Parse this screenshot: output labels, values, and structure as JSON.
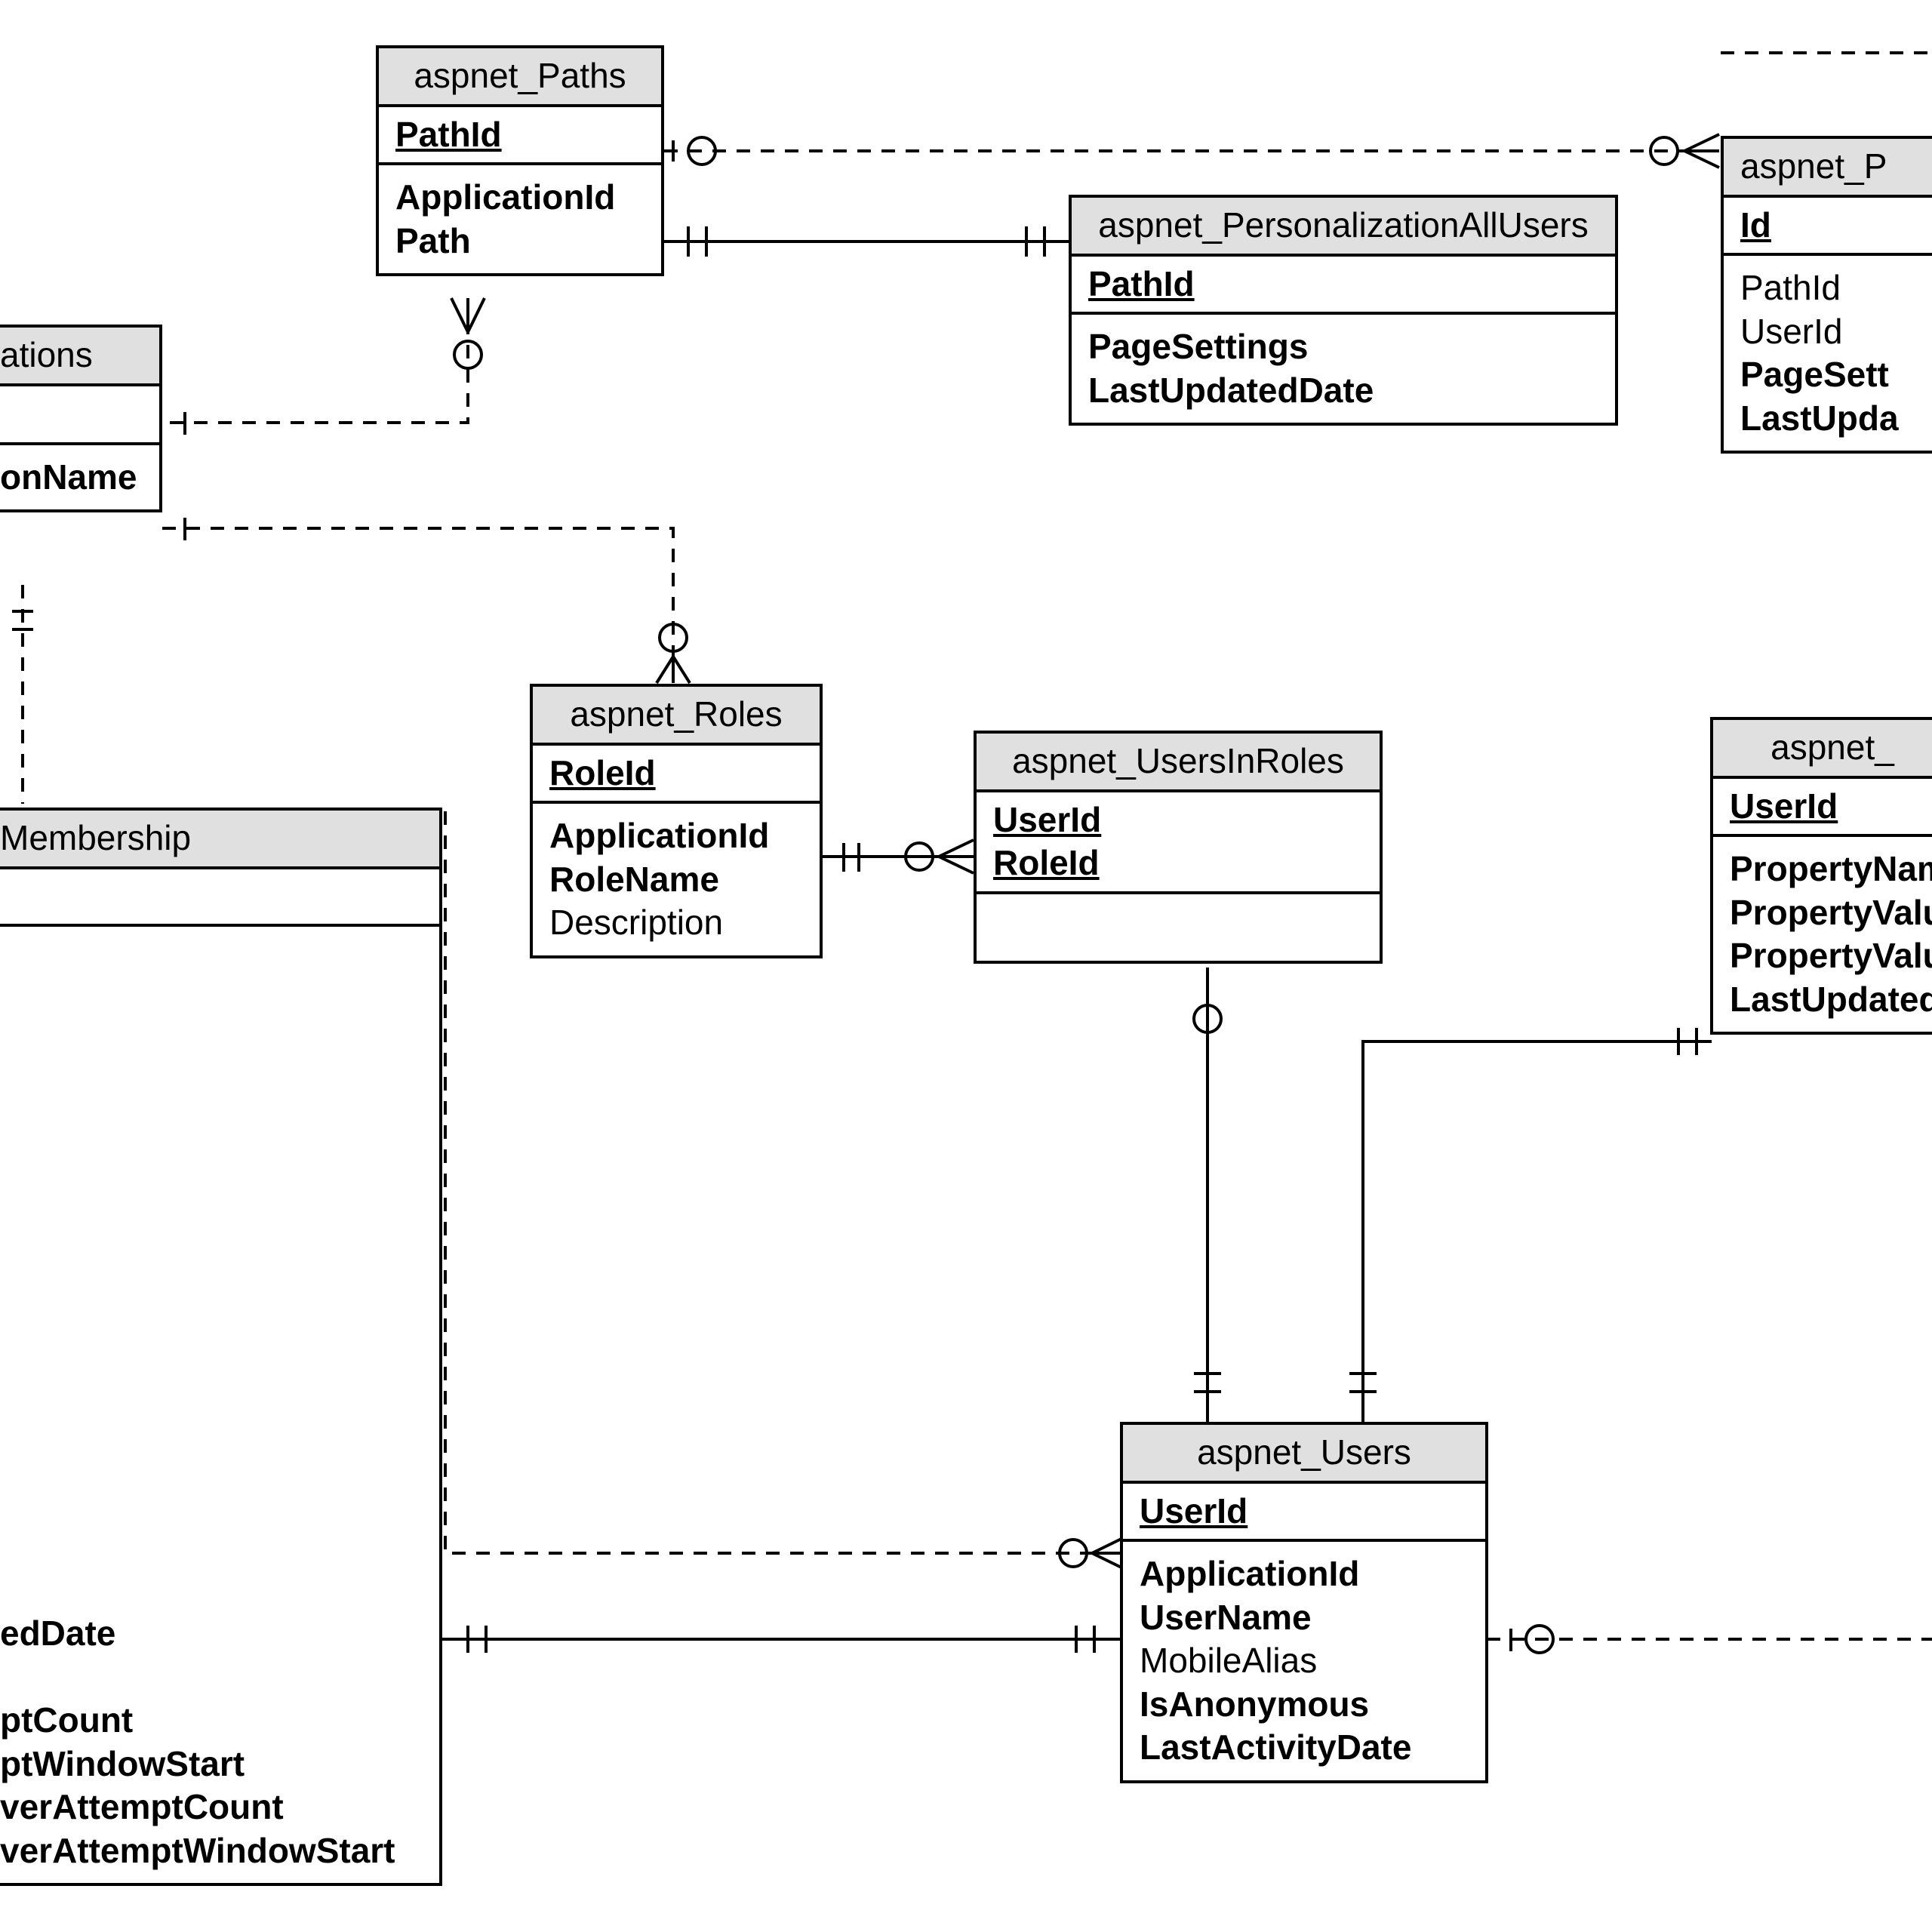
{
  "entities": {
    "paths": {
      "title": "aspnet_Paths",
      "pk": [
        "PathId"
      ],
      "attrs": [
        {
          "label": "ApplicationId",
          "bold": true
        },
        {
          "label": "Path",
          "bold": true
        }
      ]
    },
    "personalization_all": {
      "title": "aspnet_PersonalizationAllUsers",
      "pk": [
        "PathId"
      ],
      "attrs": [
        {
          "label": "PageSettings",
          "bold": true
        },
        {
          "label": "LastUpdatedDate",
          "bold": true
        }
      ]
    },
    "personalization_per": {
      "title": "aspnet_P",
      "pk": [
        "Id"
      ],
      "attrs": [
        {
          "label": "PathId",
          "bold": false
        },
        {
          "label": "UserId",
          "bold": false
        },
        {
          "label": "PageSett",
          "bold": true
        },
        {
          "label": "LastUpda",
          "bold": true
        }
      ]
    },
    "applications": {
      "title": "ations",
      "pk": [
        ""
      ],
      "attrs": [
        {
          "label": "onName",
          "bold": true
        }
      ]
    },
    "roles": {
      "title": "aspnet_Roles",
      "pk": [
        "RoleId"
      ],
      "attrs": [
        {
          "label": "ApplicationId",
          "bold": true
        },
        {
          "label": "RoleName",
          "bold": true
        },
        {
          "label": "Description",
          "bold": false
        }
      ]
    },
    "users_in_roles": {
      "title": "aspnet_UsersInRoles",
      "pk": [
        "UserId",
        "RoleId"
      ],
      "attrs": []
    },
    "profile": {
      "title": "aspnet_",
      "pk": [
        "UserId"
      ],
      "attrs": [
        {
          "label": "PropertyNam",
          "bold": true
        },
        {
          "label": "PropertyValu",
          "bold": true
        },
        {
          "label": "PropertyValu",
          "bold": true
        },
        {
          "label": "LastUpdated",
          "bold": true
        }
      ]
    },
    "membership": {
      "title": "Membership",
      "attrs": [
        {
          "label": "edDate",
          "bold": true
        },
        {
          "label": "",
          "bold": false
        },
        {
          "label": "ptCount",
          "bold": true
        },
        {
          "label": "ptWindowStart",
          "bold": true
        },
        {
          "label": "verAttemptCount",
          "bold": true
        },
        {
          "label": "verAttemptWindowStart",
          "bold": true
        }
      ]
    },
    "users": {
      "title": "aspnet_Users",
      "pk": [
        "UserId"
      ],
      "attrs": [
        {
          "label": "ApplicationId",
          "bold": true
        },
        {
          "label": "UserName",
          "bold": true
        },
        {
          "label": "MobileAlias",
          "bold": false
        },
        {
          "label": "IsAnonymous",
          "bold": true
        },
        {
          "label": "LastActivityDate",
          "bold": true
        }
      ]
    }
  }
}
